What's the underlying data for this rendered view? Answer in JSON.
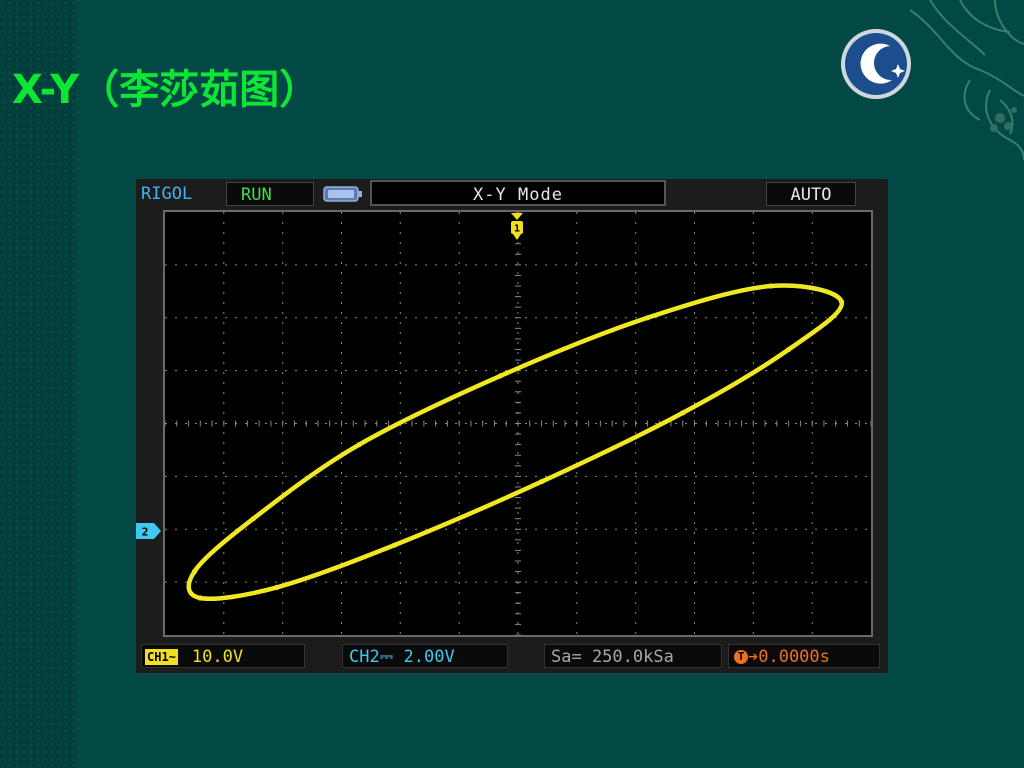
{
  "slide": {
    "title": "X-Y（李莎茹图）"
  },
  "scope": {
    "brand": "RIGOL",
    "run_state": "RUN",
    "mode": "X-Y    Mode",
    "trigger_mode": "AUTO",
    "ch1_tag": "CH1",
    "ch1_coupling": "~",
    "ch1_scale": "10.0V",
    "ch2_scale": "CH2⎓  2.00V",
    "sample_rate": "Sa= 250.0kSa",
    "trigger_glyph": "T",
    "time_offset": "➔0.0000s",
    "ch1_marker": "1",
    "ch2_marker": "2"
  },
  "colors": {
    "background": "#024946",
    "title": "#0ee636",
    "trace": "#f0e820",
    "ch2": "#40c8f0",
    "grid": "#8a8a8a"
  },
  "icons": [
    "battery-icon",
    "logo-icon",
    "decoration-ornament"
  ],
  "chart_data": {
    "type": "scatter",
    "title": "",
    "xlabel": "",
    "ylabel": "",
    "grid": true,
    "xlim": [
      -6,
      6
    ],
    "ylim": [
      -4,
      4
    ],
    "series": [
      {
        "x": [
          5.5,
          4.6,
          2.8,
          0.4,
          -2.1,
          -4.1,
          -5.4,
          -5.5,
          -4.5,
          -2.7,
          -0.3,
          2.2,
          4.3,
          5.5
        ],
        "y": [
          2.3,
          1.4,
          0.2,
          -1.1,
          -2.3,
          -3.1,
          -3.3,
          -2.8,
          -1.8,
          -0.4,
          0.9,
          2.0,
          2.6,
          2.3
        ]
      }
    ]
  }
}
